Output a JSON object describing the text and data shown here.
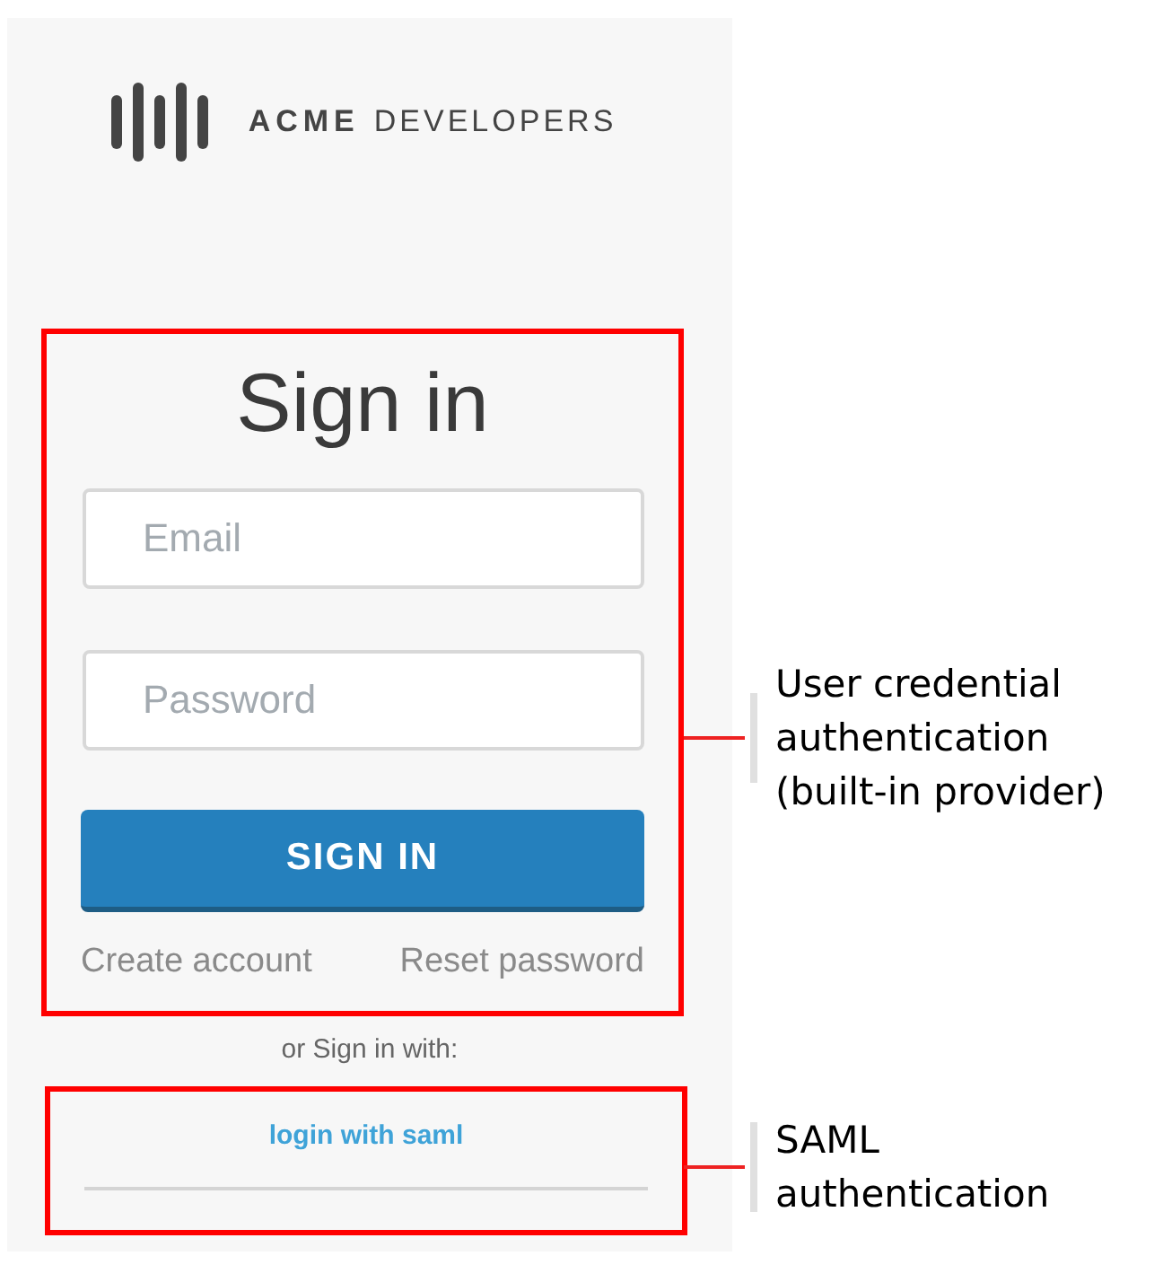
{
  "logo": {
    "brand": "ACME",
    "name": "DEVELOPERS"
  },
  "sign_in": {
    "title": "Sign in",
    "fields": [
      {
        "placeholder": "Email"
      },
      {
        "placeholder": "Password"
      }
    ],
    "button": "SIGN IN",
    "links": [
      "Create account",
      "Reset password"
    ]
  },
  "alternative": {
    "label": "or Sign in with:",
    "link": "login with saml"
  },
  "annotations": [
    {
      "text": "User credential authentication (built-in provider)"
    },
    {
      "text": "SAML authentication"
    }
  ]
}
